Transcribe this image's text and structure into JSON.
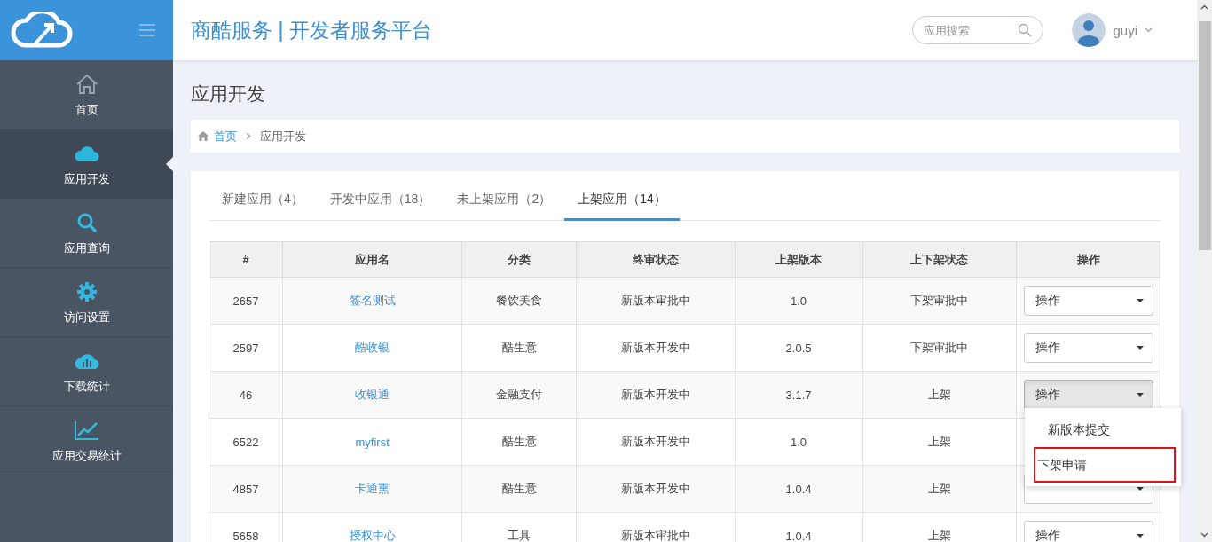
{
  "sidebar": {
    "items": [
      {
        "label": "首页",
        "selected": false
      },
      {
        "label": "应用开发",
        "selected": true
      },
      {
        "label": "应用查询",
        "selected": false
      },
      {
        "label": "访问设置",
        "selected": false
      },
      {
        "label": "下载统计",
        "selected": false
      },
      {
        "label": "应用交易统计",
        "selected": false
      }
    ]
  },
  "header": {
    "title": "商酷服务 | 开发者服务平台",
    "search": {
      "placeholder": "应用搜索"
    },
    "user": {
      "name": "guyi"
    }
  },
  "page_title": "应用开发",
  "breadcrumb": [
    {
      "label": "首页",
      "kind": "link"
    },
    {
      "label": "应用开发",
      "kind": "current"
    }
  ],
  "tabs": [
    {
      "label": "新建应用（4）",
      "selected": false
    },
    {
      "label": "开发中应用（18）",
      "selected": false
    },
    {
      "label": "未上架应用（2）",
      "selected": false
    },
    {
      "label": "上架应用（14）",
      "selected": true
    }
  ],
  "table": {
    "columns": [
      "#",
      "应用名",
      "分类",
      "终审状态",
      "上架版本",
      "上下架状态",
      "操作"
    ],
    "rows": [
      {
        "id": "2657",
        "name": "签名测试",
        "category": "餐饮美食",
        "review_status": "新版本审批中",
        "version": "1.0",
        "shelf_status": "下架审批中",
        "action": {
          "label": "操作",
          "open": false
        }
      },
      {
        "id": "2597",
        "name": "酷收银",
        "category": "酷生意",
        "review_status": "新版本开发中",
        "version": "2.0.5",
        "shelf_status": "下架审批中",
        "action": {
          "label": "操作",
          "open": false
        }
      },
      {
        "id": "46",
        "name": "收银通",
        "category": "金融支付",
        "review_status": "新版本开发中",
        "version": "3.1.7",
        "shelf_status": "上架",
        "action": {
          "label": "操作",
          "open": true
        }
      },
      {
        "id": "6522",
        "name": "myfirst",
        "category": "酷生意",
        "review_status": "新版本开发中",
        "version": "1.0",
        "shelf_status": "上架"
      },
      {
        "id": "4857",
        "name": "卡通熏",
        "category": "酷生意",
        "review_status": "新版本开发中",
        "version": "1.0.4",
        "shelf_status": "上架",
        "action": {
          "open": false
        }
      },
      {
        "id": "5658",
        "name": "授权中心",
        "category": "工具",
        "review_status": "新版本审批中",
        "version": "1.0.4",
        "shelf_status": "上架",
        "action": {
          "label": "操作",
          "open": false
        }
      }
    ]
  },
  "menu": {
    "items": [
      {
        "label": "新版本提交",
        "highlighted": false
      },
      {
        "label": "下架申请",
        "highlighted": true
      }
    ]
  }
}
